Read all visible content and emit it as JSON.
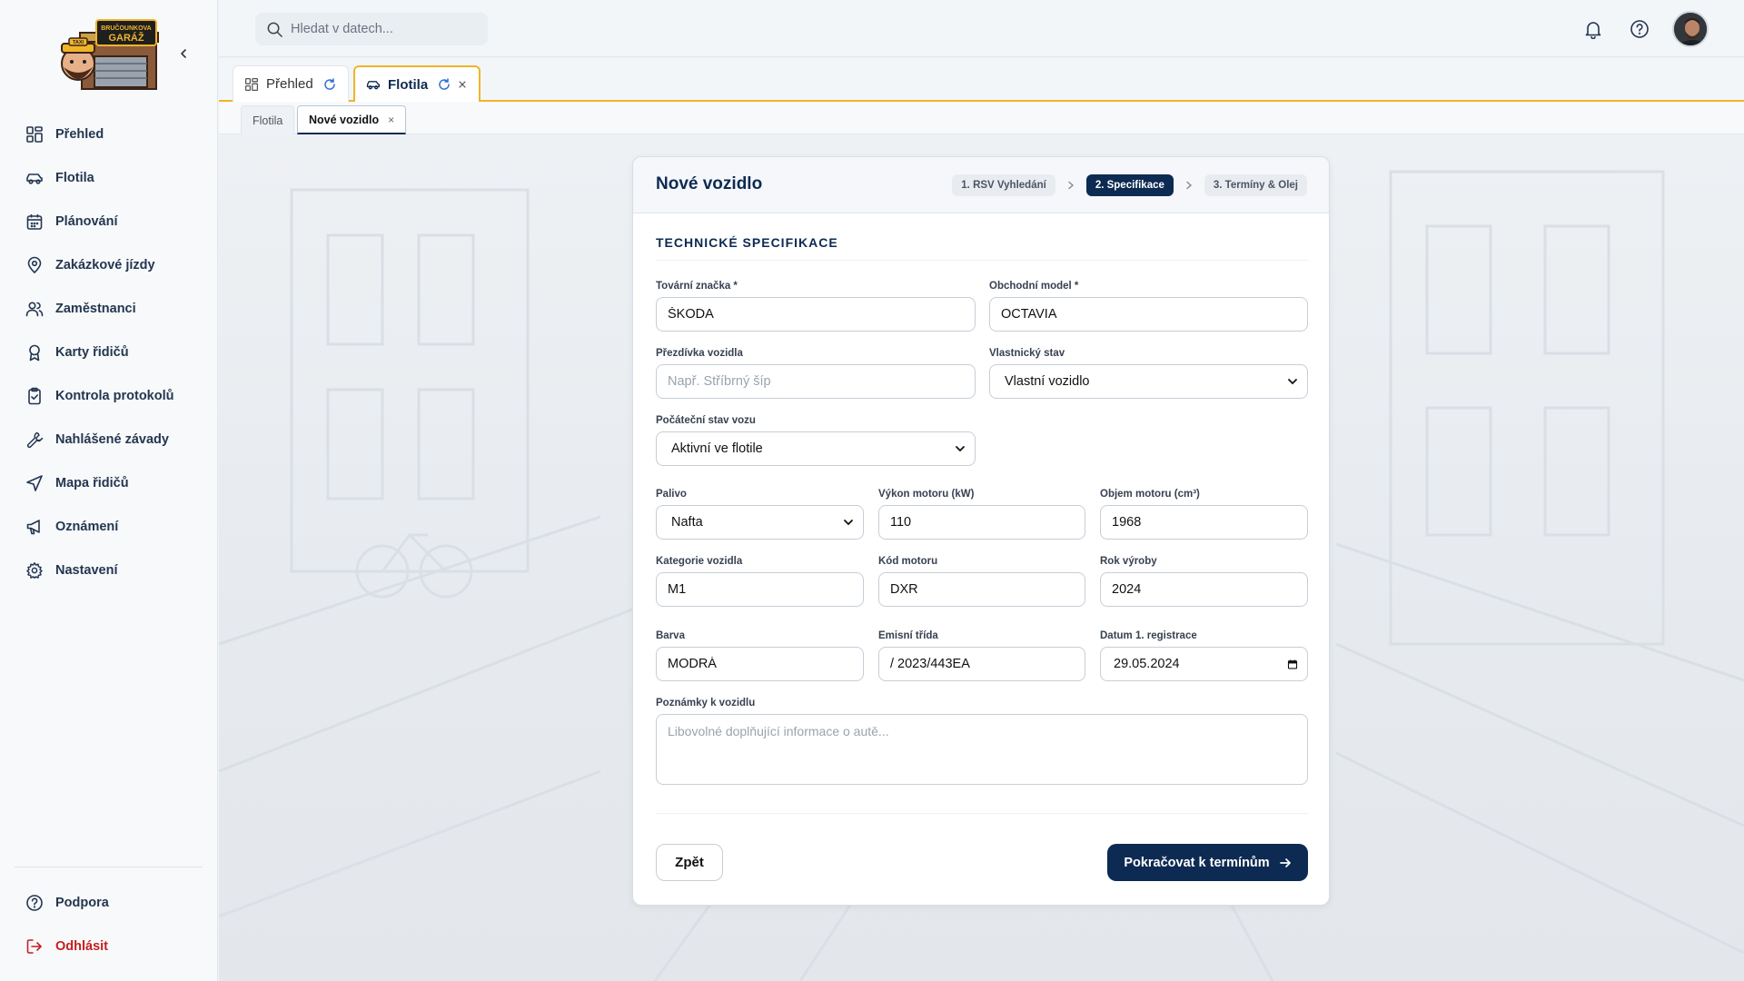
{
  "sidebar": {
    "logo_text_top": "BRUČOUNKOVA",
    "logo_text_main": "GARÁŽ",
    "logo_sign": "TAXI",
    "items": [
      {
        "label": "Přehled",
        "icon": "dashboard-icon"
      },
      {
        "label": "Flotila",
        "icon": "car-icon"
      },
      {
        "label": "Plánování",
        "icon": "calendar-icon"
      },
      {
        "label": "Zakázkové jízdy",
        "icon": "map-pin-icon"
      },
      {
        "label": "Zaměstnanci",
        "icon": "users-icon"
      },
      {
        "label": "Karty řidičů",
        "icon": "award-icon"
      },
      {
        "label": "Kontrola protokolů",
        "icon": "clipboard-check-icon"
      },
      {
        "label": "Nahlášené závady",
        "icon": "wrench-icon"
      },
      {
        "label": "Mapa řidičů",
        "icon": "navigation-icon"
      },
      {
        "label": "Oznámení",
        "icon": "megaphone-icon"
      },
      {
        "label": "Nastavení",
        "icon": "gear-icon"
      }
    ],
    "bottom": [
      {
        "label": "Podpora",
        "icon": "help-icon"
      },
      {
        "label": "Odhlásit",
        "icon": "logout-icon"
      }
    ]
  },
  "header": {
    "search_placeholder": "Hledat v datech..."
  },
  "tabs": [
    {
      "label": "Přehled",
      "active": false
    },
    {
      "label": "Flotila",
      "active": true
    }
  ],
  "subtabs": [
    {
      "label": "Flotila",
      "active": false
    },
    {
      "label": "Nové vozidlo",
      "active": true,
      "close": "×"
    }
  ],
  "form": {
    "title": "Nové vozidlo",
    "steps": [
      "1. RSV Vyhledání",
      "2. Specifikace",
      "3. Termíny & Olej"
    ],
    "active_step": 1,
    "section_title": "TECHNICKÉ SPECIFIKACE",
    "fields": {
      "brand": {
        "label": "Tovární značka *",
        "value": "ŠKODA"
      },
      "model": {
        "label": "Obchodní model *",
        "value": "OCTAVIA"
      },
      "nickname": {
        "label": "Přezdívka vozidla",
        "value": "",
        "placeholder": "Např. Stříbrný šíp"
      },
      "ownership": {
        "label": "Vlastnický stav",
        "value": "Vlastní vozidlo"
      },
      "initial_state": {
        "label": "Počáteční stav vozu",
        "value": "Aktivní ve flotile"
      },
      "fuel": {
        "label": "Palivo",
        "value": "Nafta"
      },
      "power": {
        "label": "Výkon motoru (kW)",
        "value": "110"
      },
      "displacement": {
        "label": "Objem motoru (cm³)",
        "value": "1968"
      },
      "category": {
        "label": "Kategorie vozidla",
        "value": "M1"
      },
      "engine_code": {
        "label": "Kód motoru",
        "value": "DXR"
      },
      "year": {
        "label": "Rok výroby",
        "value": "2024"
      },
      "color": {
        "label": "Barva",
        "value": "MODRÁ"
      },
      "emission": {
        "label": "Emisní třída",
        "value": "/ 2023/443EA"
      },
      "registration": {
        "label": "Datum 1. registrace",
        "value": "29.05.2024"
      },
      "notes": {
        "label": "Poznámky k vozidlu",
        "value": "",
        "placeholder": "Libovolné doplňující informace o autě..."
      }
    },
    "back_label": "Zpět",
    "next_label": "Pokračovat k termínům"
  },
  "colors": {
    "primary": "#0d2a52",
    "accent": "#f0b429",
    "logout": "#c81e1e"
  }
}
